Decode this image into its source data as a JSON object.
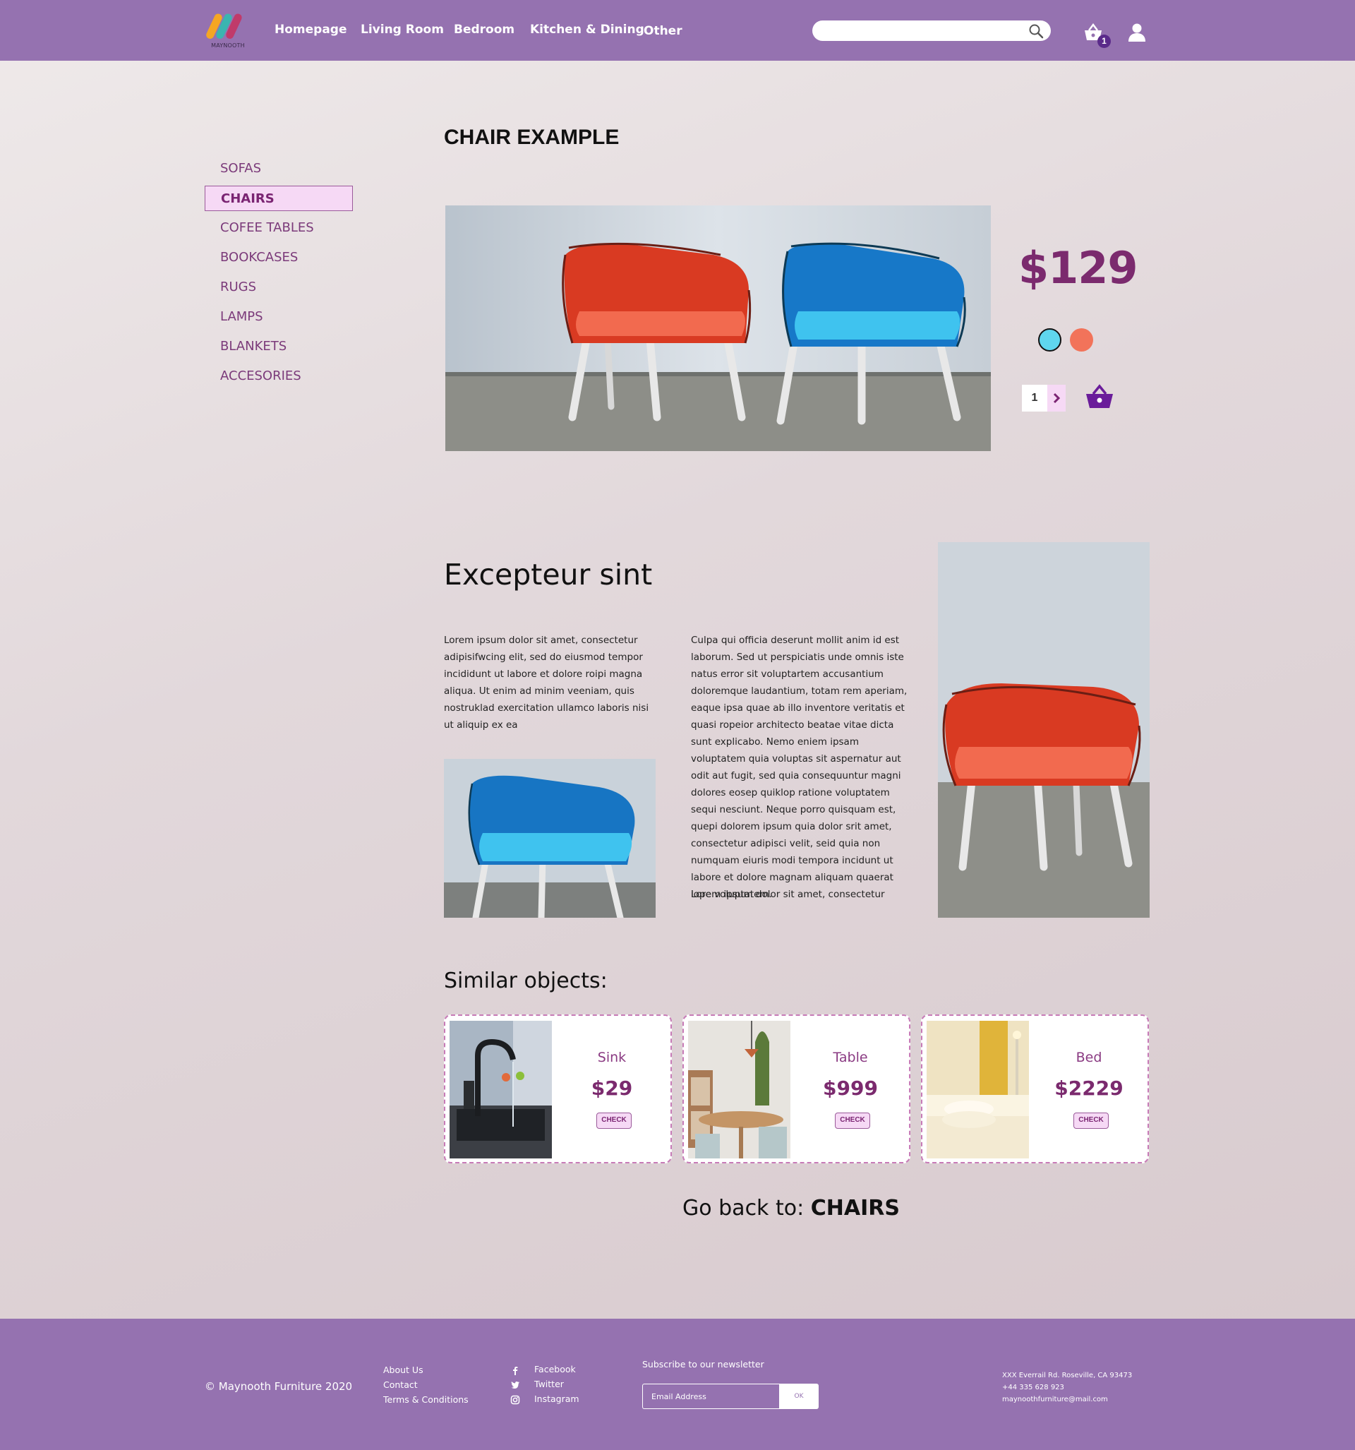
{
  "header": {
    "logo_text": "MAYNOOTH",
    "nav": [
      "Homepage",
      "Living Room",
      "Bedroom",
      "Kitchen & Dining",
      "Other"
    ],
    "search_placeholder": "",
    "cart_count": "1"
  },
  "sidebar": {
    "items": [
      {
        "label": "SOFAS"
      },
      {
        "label": "CHAIRS",
        "active": true
      },
      {
        "label": "COFEE TABLES"
      },
      {
        "label": "BOOKCASES"
      },
      {
        "label": "RUGS"
      },
      {
        "label": "LAMPS"
      },
      {
        "label": "BLANKETS"
      },
      {
        "label": "ACCESORIES"
      }
    ]
  },
  "product": {
    "title": "CHAIR EXAMPLE",
    "price": "$129",
    "colors": [
      "#5fd6ee",
      "#f2735a"
    ],
    "quantity": "1"
  },
  "description": {
    "heading": "Excepteur sint",
    "para1": "Lorem ipsum dolor sit amet, consectetur adipisifwcing elit, sed do eiusmod tempor incididunt ut labore et dolore roipi magna aliqua. Ut enim ad minim veeniam, quis nostruklad exercitation ullamco laboris nisi ut aliquip ex ea",
    "para2": "Culpa qui officia deserunt mollit anim id est laborum. Sed ut perspiciatis unde omnis iste natus error sit voluptartem accusantium doloremque laudantium, totam rem aperiam, eaque ipsa quae ab illo inventore veritatis et quasi ropeior architecto beatae vitae dicta sunt explicabo. Nemo eniem ipsam voluptatem quia voluptas sit aspernatur aut odit aut fugit, sed quia consequuntur magni dolores eosep quiklop ratione voluptatem sequi nesciunt. Neque porro quisquam est, quepi dolorem ipsum quia dolor srit amet, consectetur adipisci velit, seid quia non numquam eiuris modi tempora incidunt ut labore et dolore magnam aliquam quaerat iope voluptatem.",
    "para3": "Lorem ipsum dolor sit amet, consectetur"
  },
  "similar": {
    "heading": "Similar objects:",
    "items": [
      {
        "name": "Sink",
        "price": "$29",
        "button": "CHECK"
      },
      {
        "name": "Table",
        "price": "$999",
        "button": "CHECK"
      },
      {
        "name": "Bed",
        "price": "$2229",
        "button": "CHECK"
      }
    ]
  },
  "goback": {
    "prefix": "Go back to: ",
    "target": "CHAIRS"
  },
  "footer": {
    "copyright": "© Maynooth Furniture 2020",
    "links": [
      "About Us",
      "Contact",
      "Terms & Conditions"
    ],
    "social": [
      "Facebook",
      "Twitter",
      "Instagram"
    ],
    "newsletter_label": "Subscribe to our newsletter",
    "email_placeholder": "Email Address",
    "ok_label": "OK",
    "address": [
      "XXX Everrail Rd. Roseville, CA 93473",
      "+44 335 628 923",
      "maynoothfurniture@mail.com"
    ]
  }
}
